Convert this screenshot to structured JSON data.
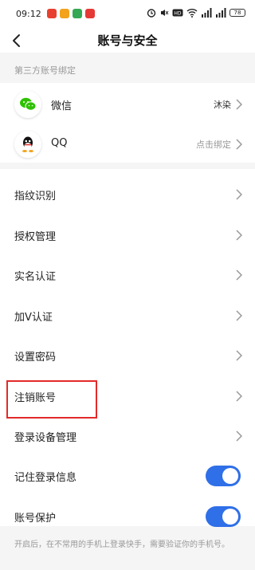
{
  "status_bar": {
    "time": "09:12",
    "battery": "78",
    "app_icon_colors": [
      "#e8402f",
      "#f2a21b",
      "#34a853",
      "#e53935"
    ],
    "signal_icons": [
      "alarm-icon",
      "mute-icon",
      "hd-icon",
      "wifi-icon",
      "signal-icon",
      "signal-icon"
    ]
  },
  "header": {
    "title": "账号与安全",
    "back_icon": "chevron-left-icon"
  },
  "third_party": {
    "section_label": "第三方账号绑定",
    "accounts": [
      {
        "icon": "wechat-icon",
        "name": "微信",
        "value": "沐染"
      },
      {
        "icon": "qq-icon",
        "name": "QQ",
        "value": "点击绑定"
      }
    ]
  },
  "settings": {
    "items": [
      {
        "label": "指纹识别",
        "type": "link"
      },
      {
        "label": "授权管理",
        "type": "link"
      },
      {
        "label": "实名认证",
        "type": "link"
      },
      {
        "label": "加V认证",
        "type": "link"
      },
      {
        "label": "设置密码",
        "type": "link"
      },
      {
        "label": "注销账号",
        "type": "link",
        "highlighted": true
      },
      {
        "label": "登录设备管理",
        "type": "link"
      },
      {
        "label": "记住登录信息",
        "type": "toggle",
        "on": true
      },
      {
        "label": "账号保护",
        "type": "toggle",
        "on": true
      }
    ]
  },
  "footer": {
    "note": "开启后，在不常用的手机上登录快手，需要验证你的手机号。"
  },
  "colors": {
    "accent": "#2f6fe8",
    "highlight": "#e32a2a",
    "wechat": "#2dc100"
  }
}
